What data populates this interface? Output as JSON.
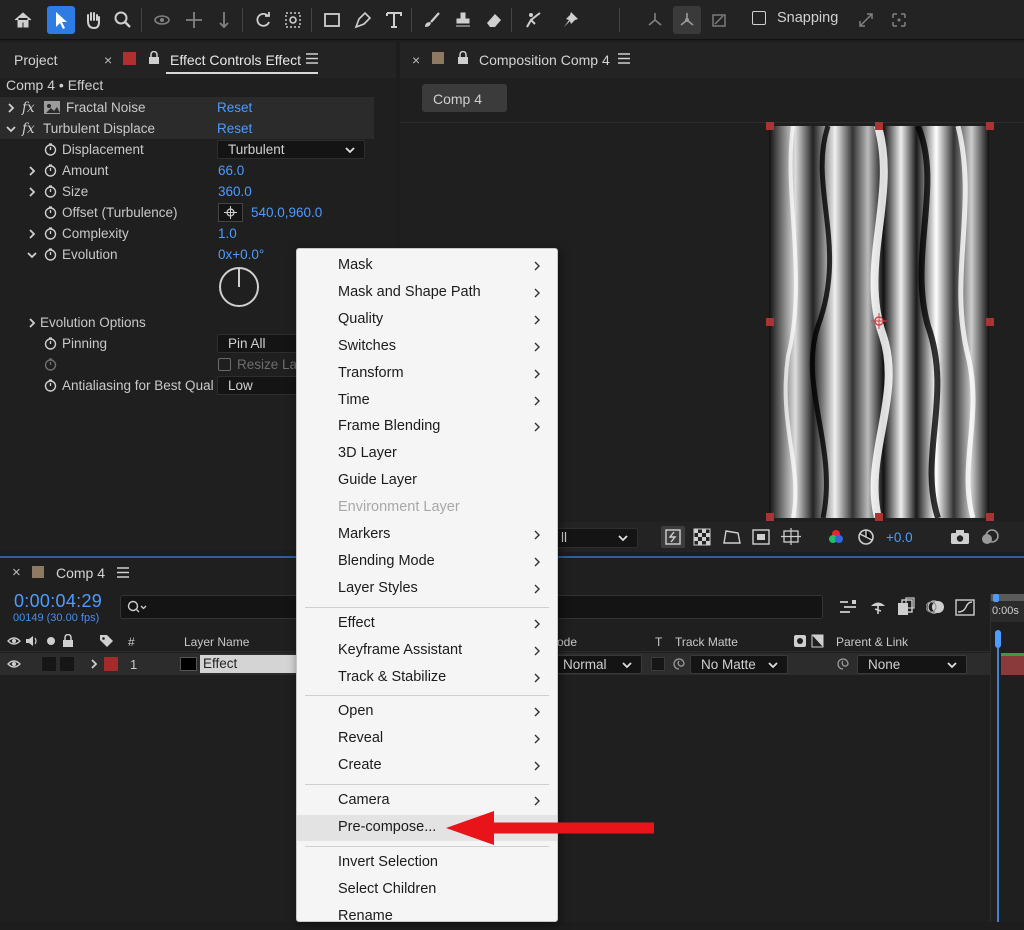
{
  "toolbar": {
    "snapping_label": "Snapping",
    "tools": [
      "home-icon",
      "selection-arrow-icon",
      "hand-icon",
      "zoom-icon",
      "orbit-camera-icon",
      "pan-camera-icon",
      "dolly-camera-icon",
      "rotate-icon",
      "pan-behind-icon",
      "rectangle-icon",
      "pen-icon",
      "type-icon",
      "brush-icon",
      "clone-stamp-icon",
      "eraser-icon",
      "roto-brush-icon",
      "puppet-pin-icon"
    ],
    "accent": "#2d7be4"
  },
  "project_panel": {
    "tab_project": "Project",
    "tab_effect_controls": "Effect Controls Effect",
    "breadcrumb": "Comp 4 • Effect",
    "label_color": "#b03030",
    "effects": [
      {
        "name": "Fractal Noise",
        "reset": "Reset"
      },
      {
        "name": "Turbulent Displace",
        "reset": "Reset"
      }
    ],
    "props": {
      "displacement": {
        "label": "Displacement",
        "value": "Turbulent"
      },
      "amount": {
        "label": "Amount",
        "value": "66.0"
      },
      "size": {
        "label": "Size",
        "value": "360.0"
      },
      "offset": {
        "label": "Offset (Turbulence)",
        "value": "540.0,960.0"
      },
      "complexity": {
        "label": "Complexity",
        "value": "1.0"
      },
      "evolution": {
        "label": "Evolution",
        "value": "0x+0.0°"
      },
      "evolution_options": {
        "label": "Evolution Options"
      },
      "pinning": {
        "label": "Pinning",
        "value": "Pin All"
      },
      "resize": {
        "label": "Resize Lay"
      },
      "antialiasing": {
        "label": "Antialiasing for Best Quali",
        "value": "Low"
      }
    }
  },
  "composition_panel": {
    "tab": "Composition Comp 4",
    "comp_button": "Comp 4",
    "dropdown_value": "ll",
    "exposure_value": "+0.0"
  },
  "timeline": {
    "tab": "Comp 4",
    "timecode": "0:00:04:29",
    "frames": "00149 (30.00 fps)",
    "search_placeholder": "",
    "col_num": "#",
    "col_layer_name": "Layer Name",
    "col_mode": "ode",
    "col_t": "T",
    "col_track_matte": "Track Matte",
    "col_parent": "Parent & Link",
    "ruler_label": "0:00s",
    "layer": {
      "index": "1",
      "name": "Effect",
      "mode": "Normal",
      "matte": "No Matte",
      "parent": "None"
    }
  },
  "context_menu": {
    "items": [
      {
        "label": "Mask",
        "submenu": true
      },
      {
        "label": "Mask and Shape Path",
        "submenu": true
      },
      {
        "label": "Quality",
        "submenu": true
      },
      {
        "label": "Switches",
        "submenu": true
      },
      {
        "label": "Transform",
        "submenu": true
      },
      {
        "label": "Time",
        "submenu": true
      },
      {
        "label": "Frame Blending",
        "submenu": true
      },
      {
        "label": "3D Layer",
        "submenu": false
      },
      {
        "label": "Guide Layer",
        "submenu": false
      },
      {
        "label": "Environment Layer",
        "submenu": false,
        "disabled": true
      },
      {
        "label": "Markers",
        "submenu": true
      },
      {
        "label": "Blending Mode",
        "submenu": true
      },
      {
        "label": "Layer Styles",
        "submenu": true
      },
      {
        "label": "Effect",
        "submenu": true
      },
      {
        "label": "Keyframe Assistant",
        "submenu": true
      },
      {
        "label": "Track & Stabilize",
        "submenu": true
      },
      {
        "label": "Open",
        "submenu": true
      },
      {
        "label": "Reveal",
        "submenu": true
      },
      {
        "label": "Create",
        "submenu": true
      },
      {
        "label": "Camera",
        "submenu": true
      },
      {
        "label": "Pre-compose...",
        "submenu": false,
        "highlighted": true
      },
      {
        "label": "Invert Selection",
        "submenu": false
      },
      {
        "label": "Select Children",
        "submenu": false
      },
      {
        "label": "Rename",
        "submenu": false
      }
    ]
  },
  "annotation": {
    "arrow_color": "#e8141a"
  }
}
